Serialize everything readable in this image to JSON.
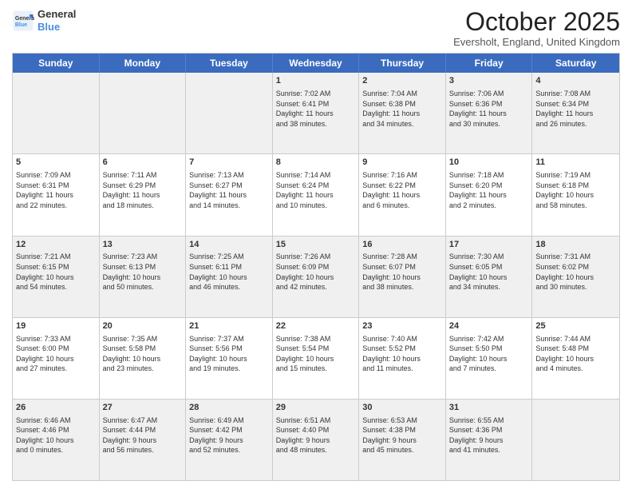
{
  "logo": {
    "line1": "General",
    "line2": "Blue"
  },
  "title": "October 2025",
  "location": "Eversholt, England, United Kingdom",
  "days_of_week": [
    "Sunday",
    "Monday",
    "Tuesday",
    "Wednesday",
    "Thursday",
    "Friday",
    "Saturday"
  ],
  "weeks": [
    [
      {
        "day": "",
        "text": ""
      },
      {
        "day": "",
        "text": ""
      },
      {
        "day": "",
        "text": ""
      },
      {
        "day": "1",
        "text": "Sunrise: 7:02 AM\nSunset: 6:41 PM\nDaylight: 11 hours\nand 38 minutes."
      },
      {
        "day": "2",
        "text": "Sunrise: 7:04 AM\nSunset: 6:38 PM\nDaylight: 11 hours\nand 34 minutes."
      },
      {
        "day": "3",
        "text": "Sunrise: 7:06 AM\nSunset: 6:36 PM\nDaylight: 11 hours\nand 30 minutes."
      },
      {
        "day": "4",
        "text": "Sunrise: 7:08 AM\nSunset: 6:34 PM\nDaylight: 11 hours\nand 26 minutes."
      }
    ],
    [
      {
        "day": "5",
        "text": "Sunrise: 7:09 AM\nSunset: 6:31 PM\nDaylight: 11 hours\nand 22 minutes."
      },
      {
        "day": "6",
        "text": "Sunrise: 7:11 AM\nSunset: 6:29 PM\nDaylight: 11 hours\nand 18 minutes."
      },
      {
        "day": "7",
        "text": "Sunrise: 7:13 AM\nSunset: 6:27 PM\nDaylight: 11 hours\nand 14 minutes."
      },
      {
        "day": "8",
        "text": "Sunrise: 7:14 AM\nSunset: 6:24 PM\nDaylight: 11 hours\nand 10 minutes."
      },
      {
        "day": "9",
        "text": "Sunrise: 7:16 AM\nSunset: 6:22 PM\nDaylight: 11 hours\nand 6 minutes."
      },
      {
        "day": "10",
        "text": "Sunrise: 7:18 AM\nSunset: 6:20 PM\nDaylight: 11 hours\nand 2 minutes."
      },
      {
        "day": "11",
        "text": "Sunrise: 7:19 AM\nSunset: 6:18 PM\nDaylight: 10 hours\nand 58 minutes."
      }
    ],
    [
      {
        "day": "12",
        "text": "Sunrise: 7:21 AM\nSunset: 6:15 PM\nDaylight: 10 hours\nand 54 minutes."
      },
      {
        "day": "13",
        "text": "Sunrise: 7:23 AM\nSunset: 6:13 PM\nDaylight: 10 hours\nand 50 minutes."
      },
      {
        "day": "14",
        "text": "Sunrise: 7:25 AM\nSunset: 6:11 PM\nDaylight: 10 hours\nand 46 minutes."
      },
      {
        "day": "15",
        "text": "Sunrise: 7:26 AM\nSunset: 6:09 PM\nDaylight: 10 hours\nand 42 minutes."
      },
      {
        "day": "16",
        "text": "Sunrise: 7:28 AM\nSunset: 6:07 PM\nDaylight: 10 hours\nand 38 minutes."
      },
      {
        "day": "17",
        "text": "Sunrise: 7:30 AM\nSunset: 6:05 PM\nDaylight: 10 hours\nand 34 minutes."
      },
      {
        "day": "18",
        "text": "Sunrise: 7:31 AM\nSunset: 6:02 PM\nDaylight: 10 hours\nand 30 minutes."
      }
    ],
    [
      {
        "day": "19",
        "text": "Sunrise: 7:33 AM\nSunset: 6:00 PM\nDaylight: 10 hours\nand 27 minutes."
      },
      {
        "day": "20",
        "text": "Sunrise: 7:35 AM\nSunset: 5:58 PM\nDaylight: 10 hours\nand 23 minutes."
      },
      {
        "day": "21",
        "text": "Sunrise: 7:37 AM\nSunset: 5:56 PM\nDaylight: 10 hours\nand 19 minutes."
      },
      {
        "day": "22",
        "text": "Sunrise: 7:38 AM\nSunset: 5:54 PM\nDaylight: 10 hours\nand 15 minutes."
      },
      {
        "day": "23",
        "text": "Sunrise: 7:40 AM\nSunset: 5:52 PM\nDaylight: 10 hours\nand 11 minutes."
      },
      {
        "day": "24",
        "text": "Sunrise: 7:42 AM\nSunset: 5:50 PM\nDaylight: 10 hours\nand 7 minutes."
      },
      {
        "day": "25",
        "text": "Sunrise: 7:44 AM\nSunset: 5:48 PM\nDaylight: 10 hours\nand 4 minutes."
      }
    ],
    [
      {
        "day": "26",
        "text": "Sunrise: 6:46 AM\nSunset: 4:46 PM\nDaylight: 10 hours\nand 0 minutes."
      },
      {
        "day": "27",
        "text": "Sunrise: 6:47 AM\nSunset: 4:44 PM\nDaylight: 9 hours\nand 56 minutes."
      },
      {
        "day": "28",
        "text": "Sunrise: 6:49 AM\nSunset: 4:42 PM\nDaylight: 9 hours\nand 52 minutes."
      },
      {
        "day": "29",
        "text": "Sunrise: 6:51 AM\nSunset: 4:40 PM\nDaylight: 9 hours\nand 48 minutes."
      },
      {
        "day": "30",
        "text": "Sunrise: 6:53 AM\nSunset: 4:38 PM\nDaylight: 9 hours\nand 45 minutes."
      },
      {
        "day": "31",
        "text": "Sunrise: 6:55 AM\nSunset: 4:36 PM\nDaylight: 9 hours\nand 41 minutes."
      },
      {
        "day": "",
        "text": ""
      }
    ]
  ],
  "shaded_rows": [
    0,
    2,
    4
  ]
}
